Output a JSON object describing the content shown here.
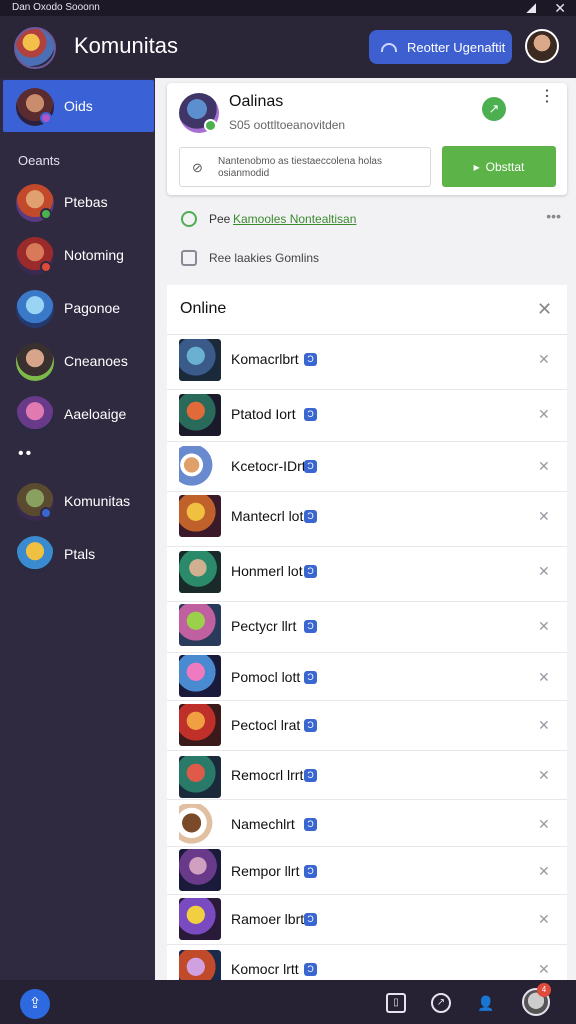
{
  "status_bar": {
    "title": "Dan Oxodo Sooonn",
    "close": "✕"
  },
  "header": {
    "title": "Komunitas",
    "action_label": "Reotter Ugenaftit"
  },
  "sidebar": {
    "active": {
      "label": "Oids"
    },
    "section_label": "Oeants",
    "items": [
      {
        "label": "Ptebas",
        "badge_color": "#4caf50"
      },
      {
        "label": "Notoming",
        "badge_color": ""
      },
      {
        "label": "Pagonoe",
        "badge_color": ""
      },
      {
        "label": "Cneanoes",
        "badge_color": ""
      },
      {
        "label": "Aaeloaige",
        "badge_color": ""
      }
    ],
    "separator": "••",
    "items2": [
      {
        "label": "Komunitas",
        "badge_color": "#3a66d0"
      },
      {
        "label": "Ptals",
        "badge_color": ""
      }
    ]
  },
  "card": {
    "title": "Oalinas",
    "subtitle": "S05 oottltoeanovitden",
    "edit_icon": "↗",
    "menu_icon": "⋮",
    "field_text": "Nantenobmo as tiestaeccolena holas osianmodid",
    "cta_label": "Obsttat"
  },
  "actions": [
    {
      "prefix": "Pee",
      "link": "Kamooles Nontealtisan",
      "more": "•••"
    },
    {
      "text": "Ree laakies Gomlins"
    }
  ],
  "online": {
    "title": "Online",
    "close": "✕",
    "members": [
      {
        "name": "Komacrlbrt",
        "badge": "Ɔ"
      },
      {
        "name": "Ptatod Iort",
        "badge": "Ɔ"
      },
      {
        "name": "Kcetocr-IDrt",
        "badge": "Ɔ"
      },
      {
        "name": "Mantecrl lot",
        "badge": "Ɔ"
      },
      {
        "name": "Honmerl lot",
        "badge": "Ɔ"
      },
      {
        "name": "Pectycr llrt",
        "badge": "Ɔ"
      },
      {
        "name": "Pomocl lott",
        "badge": "Ɔ"
      },
      {
        "name": "Pectocl lrat",
        "badge": "Ɔ"
      },
      {
        "name": "Remocrl lrrt",
        "badge": "Ɔ"
      },
      {
        "name": "Namechlrt",
        "badge": "Ɔ"
      },
      {
        "name": "Rempor llrt",
        "badge": "Ɔ"
      },
      {
        "name": "Ramoer lbrt",
        "badge": "Ɔ"
      },
      {
        "name": "Komocr lrtt",
        "badge": "Ɔ"
      }
    ]
  },
  "bottom_bar": {
    "notification_count": "4"
  },
  "colors": {
    "accent": "#3a62d6",
    "cta": "#5cb448",
    "sidebar_bg": "#2f2a40"
  }
}
